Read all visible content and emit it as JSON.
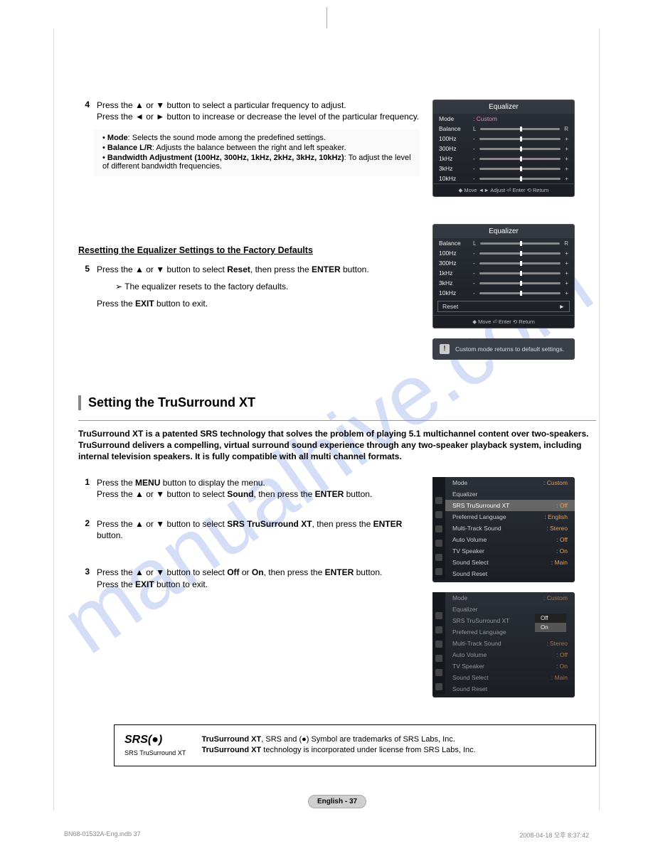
{
  "step4": {
    "num": "4",
    "line1_a": "Press the ",
    "line1_b": " or ",
    "line1_c": " button to select a particular frequency to adjust.",
    "line2_a": "Press the ",
    "line2_b": " or ",
    "line2_c": " button to increase or decrease the level of the particular frequency."
  },
  "notes4": {
    "mode_label": "Mode",
    "mode_text": ": Selects the sound mode among the predefined settings.",
    "balance_label": "Balance L/R",
    "balance_text": ": Adjusts the balance between the right and left speaker.",
    "bw_label": "Bandwidth Adjustment (100Hz, 300Hz, 1kHz, 2kHz, 3kHz, 10kHz)",
    "bw_text": ": To adjust the level of different bandwidth frequencies."
  },
  "reset_heading": "Resetting the Equalizer Settings to the Factory Defaults",
  "step5": {
    "num": "5",
    "line1_a": "Press the ",
    "line1_b": " or ",
    "line1_c": " button to select ",
    "reset": "Reset",
    "line1_d": ", then press the ",
    "enter": "ENTER",
    "line1_e": " button.",
    "note": "The equalizer resets to the factory defaults.",
    "exit_a": "Press the ",
    "exit_b": "EXIT",
    "exit_c": " button to exit."
  },
  "tsx_title": "Setting the TruSurround XT",
  "tsx_intro": "TruSurround XT is a patented SRS technology that solves the problem of playing 5.1 multichannel content over two-speakers. TruSurround delivers a compelling, virtual surround sound experience through any two-speaker playback system, including internal television speakers. It is fully compatible with all multi channel formats.",
  "ts1": {
    "num": "1",
    "l1a": "Press the ",
    "l1b": "MENU",
    "l1c": " button to display the menu.",
    "l2a": "Press the ",
    "l2b": " or ",
    "l2c": " button to select ",
    "sound": "Sound",
    "l2d": ", then press the ",
    "enter": "ENTER",
    "l2e": " button."
  },
  "ts2": {
    "num": "2",
    "l1a": "Press the ",
    "l1b": " or ",
    "l1c": " button to select ",
    "srs": "SRS TruSurround XT",
    "l1d": ", then press the ",
    "enter": "ENTER",
    "l1e": " button."
  },
  "ts3": {
    "num": "3",
    "l1a": "Press the ",
    "l1b": " or ",
    "l1c": " button to select ",
    "off": "Off",
    "or": " or ",
    "on": "On",
    "l1d": ", then press the ",
    "enter": "ENTER",
    "l1e": " button.",
    "exit_a": "Press the ",
    "exit_b": "EXIT",
    "exit_c": " button to exit."
  },
  "osd_eq": {
    "title": "Equalizer",
    "mode_label": "Mode",
    "mode_value": ": Custom",
    "rows": [
      "Balance",
      "100Hz",
      "300Hz",
      "1kHz",
      "3kHz",
      "10kHz"
    ],
    "endL": "L",
    "endR": "R",
    "footer": "◆ Move   ◄► Adjust   ⏎ Enter   ⟲ Return"
  },
  "osd_eq2": {
    "reset": "Reset",
    "footer": "◆ Move   ⏎ Enter   ⟲ Return"
  },
  "osd_alert": "Custom mode returns to default settings.",
  "osd_sound1": {
    "rows": [
      {
        "k": "Mode",
        "v": ": Custom"
      },
      {
        "k": "Equalizer",
        "v": ""
      },
      {
        "k": "SRS TruSurround XT",
        "v": ": Off",
        "sel": true
      },
      {
        "k": "Preferred Language",
        "v": ": English"
      },
      {
        "k": "Multi-Track Sound",
        "v": ": Stereo"
      },
      {
        "k": "Auto Volume",
        "v": ": Off"
      },
      {
        "k": "TV Speaker",
        "v": ": On"
      },
      {
        "k": "Sound Select",
        "v": ": Main"
      },
      {
        "k": "Sound Reset",
        "v": ""
      }
    ]
  },
  "osd_sound2_popup": {
    "off": "Off",
    "on": "On"
  },
  "trademark": {
    "logo": "SRS(●)",
    "logo_sub": "SRS TruSurround XT",
    "line1_a": "TruSurround XT",
    "line1_b": ", SRS and (●) Symbol are trademarks of SRS Labs, Inc.",
    "line2_a": "TruSurround XT",
    "line2_b": " technology is incorporated under license from SRS Labs, Inc."
  },
  "page_num": "English - 37",
  "footer_left": "BN68-01532A-Eng.indb   37",
  "footer_right": "2008-04-18   오후 8:37:42"
}
